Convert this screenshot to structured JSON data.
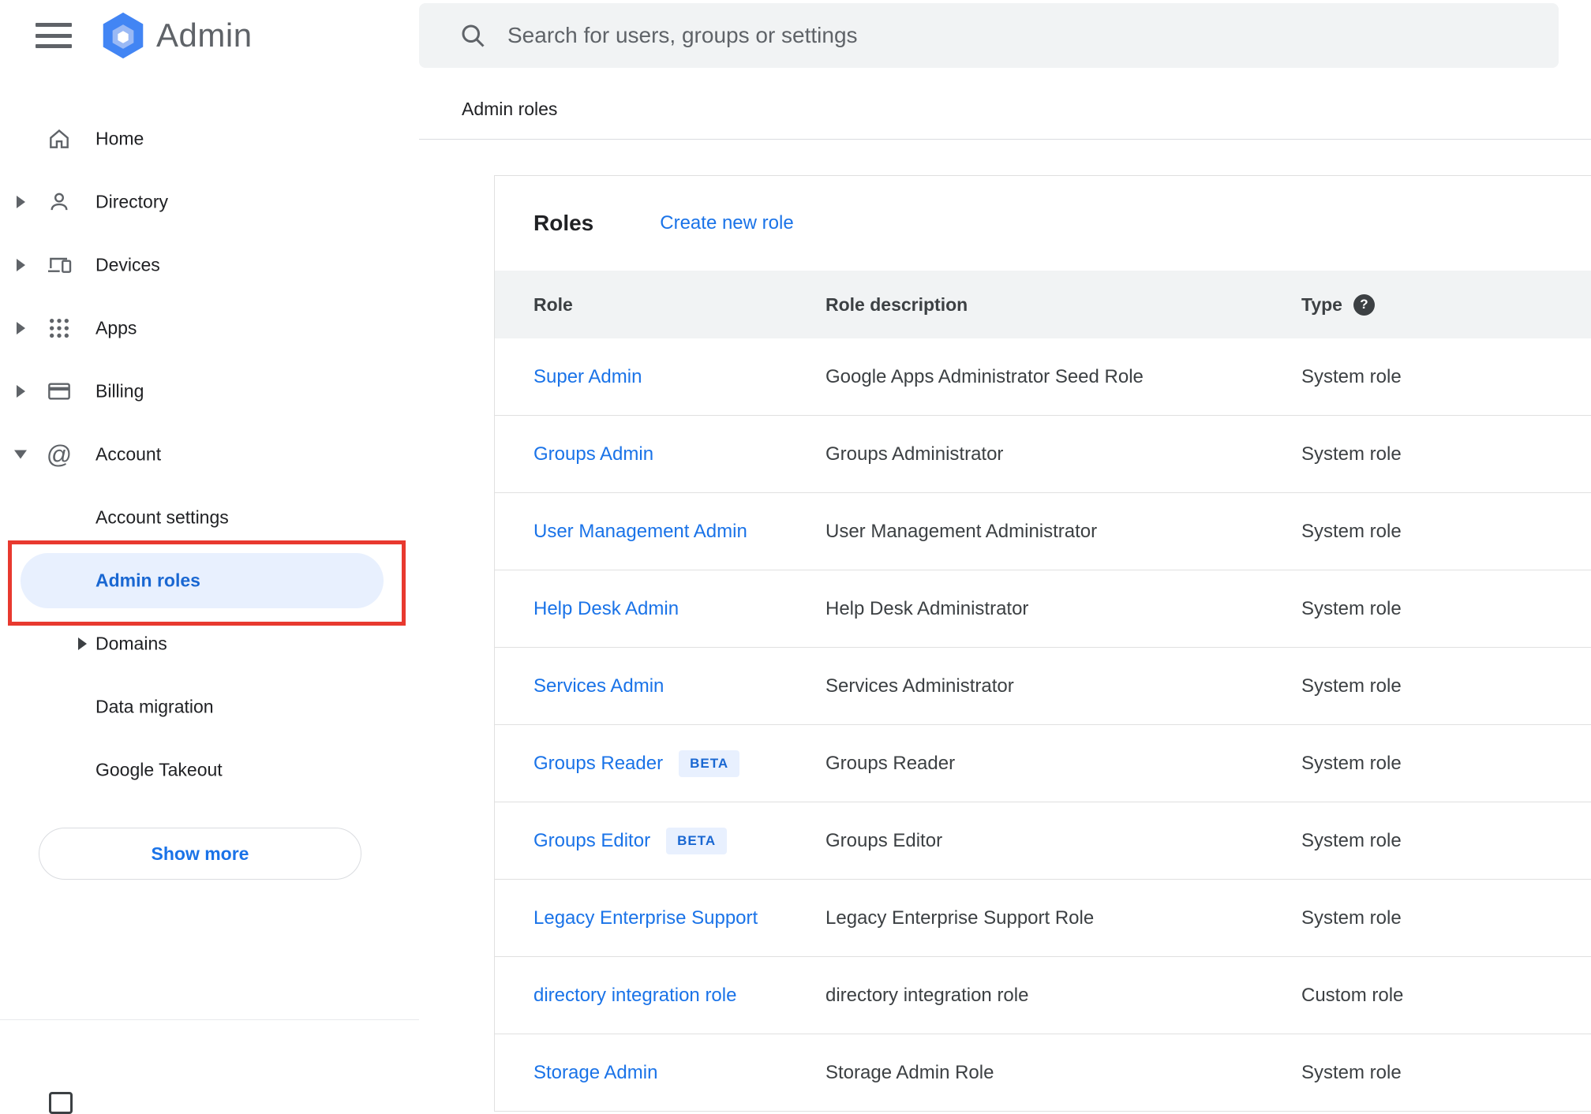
{
  "colors": {
    "link_blue": "#1a73e8",
    "selected_item_bg": "#e8f0fe",
    "selected_item_text": "#1967d2",
    "annotation_red": "#e8392f",
    "table_header_bg": "#f1f3f4",
    "search_bg": "#f1f3f4",
    "badge_bg": "#e8f0fe",
    "badge_text": "#1967d2",
    "text_primary": "#202124",
    "text_secondary": "#3c4043",
    "icon_gray": "#5f6368",
    "logo_blue": "#4285f4"
  },
  "sidebar": {
    "app_name": "Admin",
    "items": [
      {
        "label": "Home"
      },
      {
        "label": "Directory"
      },
      {
        "label": "Devices"
      },
      {
        "label": "Apps"
      },
      {
        "label": "Billing"
      },
      {
        "label": "Account"
      }
    ],
    "account_subitems": [
      {
        "label": "Account settings"
      },
      {
        "label": "Admin roles"
      },
      {
        "label": "Domains"
      },
      {
        "label": "Data migration"
      },
      {
        "label": "Google Takeout"
      }
    ],
    "show_more_label": "Show more"
  },
  "search": {
    "placeholder": "Search for users, groups or settings"
  },
  "breadcrumb": "Admin roles",
  "roles_panel": {
    "title": "Roles",
    "create_link": "Create new role",
    "columns": {
      "role": "Role",
      "description": "Role description",
      "type": "Type"
    },
    "help_glyph": "?",
    "rows": [
      {
        "role": "Super Admin",
        "description": "Google Apps Administrator Seed Role",
        "type": "System role"
      },
      {
        "role": "Groups Admin",
        "description": "Groups Administrator",
        "type": "System role"
      },
      {
        "role": "User Management Admin",
        "description": "User Management Administrator",
        "type": "System role"
      },
      {
        "role": "Help Desk Admin",
        "description": "Help Desk Administrator",
        "type": "System role"
      },
      {
        "role": "Services Admin",
        "description": "Services Administrator",
        "type": "System role"
      },
      {
        "role": "Groups Reader",
        "badge": "BETA",
        "description": "Groups Reader",
        "type": "System role"
      },
      {
        "role": "Groups Editor",
        "badge": "BETA",
        "description": "Groups Editor",
        "type": "System role"
      },
      {
        "role": "Legacy Enterprise Support",
        "description": "Legacy Enterprise Support Role",
        "type": "System role"
      },
      {
        "role": "directory integration role",
        "description": "directory integration role",
        "type": "Custom role"
      },
      {
        "role": "Storage Admin",
        "description": "Storage Admin Role",
        "type": "System role"
      }
    ]
  }
}
